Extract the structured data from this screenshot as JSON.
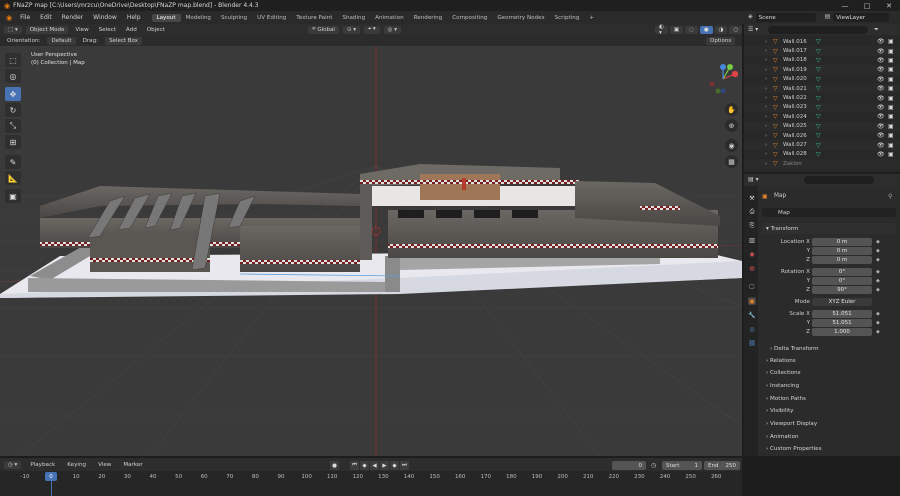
{
  "window": {
    "title": "FNaZP map [C:\\Users\\mrzcu\\OneDrive\\Desktop\\FNaZP map.blend] - Blender 4.4.3",
    "controls": [
      "—",
      "□",
      "✕"
    ]
  },
  "menu": {
    "items": [
      "File",
      "Edit",
      "Render",
      "Window",
      "Help"
    ],
    "workspaces": [
      "Layout",
      "Modeling",
      "Sculpting",
      "UV Editing",
      "Texture Paint",
      "Shading",
      "Animation",
      "Rendering",
      "Compositing",
      "Geometry Nodes",
      "Scripting"
    ],
    "active_workspace": "Layout",
    "add_tab": "+",
    "scene": "Scene",
    "view_layer": "ViewLayer"
  },
  "viewport_header": {
    "mode": "Object Mode",
    "menus": [
      "View",
      "Select",
      "Add",
      "Object"
    ],
    "transform": "Global",
    "orientation_label": "Orientation:",
    "orientation_value": "Default",
    "drag_label": "Drag:",
    "drag_value": "Select Box",
    "options": "Options"
  },
  "viewport": {
    "perspective": "User Perspective",
    "collection": "(0) Collection | Map",
    "axes": {
      "x": "X",
      "y": "Y",
      "z": "Z"
    }
  },
  "outliner": {
    "search_placeholder": "",
    "rows": [
      "Wall.016",
      "Wall.017",
      "Wall.018",
      "Wall.019",
      "Wall.020",
      "Wall.021",
      "Wall.022",
      "Wall.023",
      "Wall.024",
      "Wall.025",
      "Wall.026",
      "Wall.027",
      "Wall.028",
      "Zaklon"
    ]
  },
  "properties": {
    "object_name": "Map",
    "data_name": "Map",
    "transform_label": "Transform",
    "location_x_label": "Location X",
    "y_label": "Y",
    "z_label": "Z",
    "rotation_x_label": "Rotation X",
    "mode_label": "Mode",
    "scale_x_label": "Scale X",
    "location": [
      "0 m",
      "0 m",
      "0 m"
    ],
    "rotation": [
      "0°",
      "0°",
      "90°"
    ],
    "mode": "XYZ Euler",
    "scale": [
      "51.051",
      "51.051",
      "1.000"
    ],
    "delta": "Delta Transform",
    "panels": [
      "Relations",
      "Collections",
      "Instancing",
      "Motion Paths",
      "Visibility",
      "Viewport Display",
      "Animation",
      "Custom Properties"
    ]
  },
  "timeline": {
    "menus": [
      "Playback",
      "Keying",
      "View",
      "Marker"
    ],
    "current_frame": "0",
    "start_label": "Start",
    "start": "1",
    "end_label": "End",
    "end": "250",
    "ticks": [
      "-10",
      "0",
      "10",
      "20",
      "30",
      "40",
      "50",
      "60",
      "70",
      "80",
      "90",
      "100",
      "110",
      "120",
      "130",
      "140",
      "150",
      "160",
      "170",
      "180",
      "190",
      "200",
      "210",
      "220",
      "230",
      "240",
      "250",
      "260"
    ],
    "playhead": "0"
  }
}
